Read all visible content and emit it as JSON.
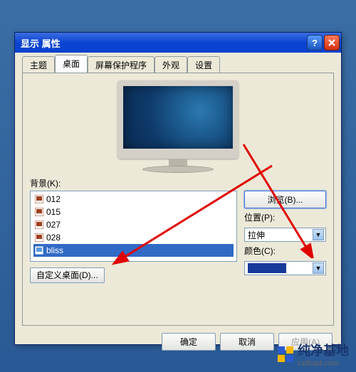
{
  "window": {
    "title": "显示 属性",
    "help": "?",
    "close": "×"
  },
  "tabs": [
    "主题",
    "桌面",
    "屏幕保护程序",
    "外观",
    "设置"
  ],
  "activeTabIndex": 1,
  "background": {
    "label": "背景(K):",
    "items": [
      {
        "name": "012",
        "type": "image"
      },
      {
        "name": "015",
        "type": "image"
      },
      {
        "name": "027",
        "type": "image"
      },
      {
        "name": "028",
        "type": "image"
      },
      {
        "name": "bliss",
        "type": "bmp",
        "selected": true
      }
    ],
    "customize": "自定义桌面(D)..."
  },
  "side": {
    "browse": "浏览(B)...",
    "position_label": "位置(P):",
    "position_value": "拉伸",
    "color_label": "颜色(C):",
    "color_value": "#1a3a9a"
  },
  "buttons": {
    "ok": "确定",
    "cancel": "取消",
    "apply": "应用(A)"
  },
  "watermark": {
    "text": "纯净基地",
    "sub": "czlload.com"
  }
}
